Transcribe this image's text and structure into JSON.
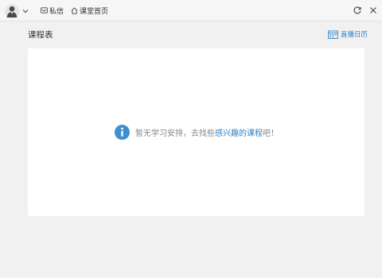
{
  "topbar": {
    "avatar_icon": "user-avatar-icon",
    "dropdown_icon": "chevron-down-icon",
    "nav": [
      {
        "label": "私信",
        "icon": "message-icon"
      },
      {
        "label": "课堂首页",
        "icon": "home-icon"
      }
    ],
    "refresh_icon": "refresh-icon",
    "close_icon": "close-icon"
  },
  "page": {
    "title": "课程表",
    "calendar_link": "直播日历",
    "calendar_icon": "calendar-icon"
  },
  "empty_state": {
    "icon": "info-icon",
    "text_before": "暂无学习安排，去找些",
    "link_text": "感兴趣的课程",
    "text_after": "吧！"
  },
  "colors": {
    "accent": "#2f7fc1",
    "background": "#f1f1f1",
    "panel": "#ffffff",
    "info_icon": "#3d8fd1"
  }
}
